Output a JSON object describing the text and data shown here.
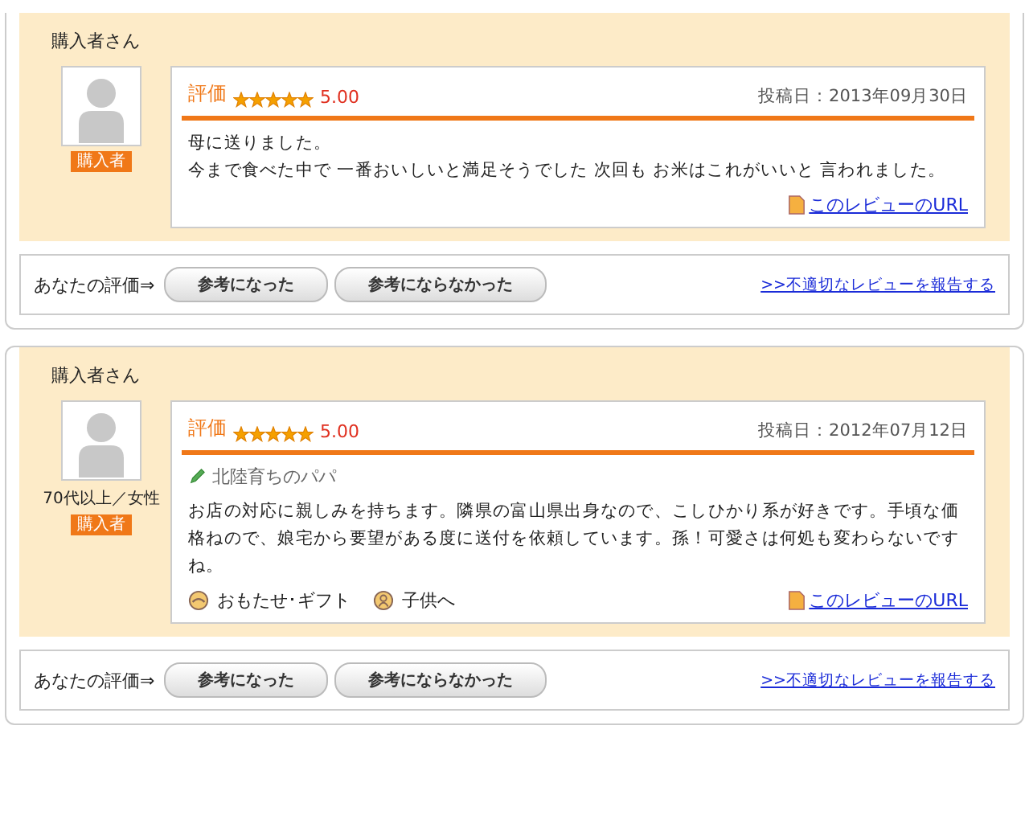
{
  "reviews": [
    {
      "reviewer": "購入者さん",
      "badge": "購入者",
      "rating_label": "評価",
      "stars": 5,
      "score": "5.00",
      "date": "投稿日：2013年09月30日",
      "body": [
        "母に送りました。",
        "今まで食べた中で 一番おいしいと満足そうでした 次回も お米はこれがいいと 言われました。"
      ],
      "url_link": "このレビューのURL",
      "feedback_label": "あなたの評価⇒",
      "buttons": [
        "参考になった",
        "参考にならなかった"
      ],
      "report_link": ">>不適切なレビューを報告する"
    },
    {
      "reviewer": "購入者さん",
      "profile": "70代以上／女性",
      "badge": "購入者",
      "rating_label": "評価",
      "stars": 5,
      "score": "5.00",
      "date": "投稿日：2012年07月12日",
      "nickname": "北陸育ちのパパ",
      "body": [
        "お店の対応に親しみを持ちます。隣県の富山県出身なので、こしひかり系が好きです。手頃な価格ねので、娘宅から要望がある度に送付を依頼しています。孫！可愛さは何処も変わらないですね。"
      ],
      "tags": [
        {
          "kind": "gift",
          "label": "おもたせ･ギフト"
        },
        {
          "kind": "person",
          "label": "子供へ"
        }
      ],
      "url_link": "このレビューのURL",
      "feedback_label": "あなたの評価⇒",
      "buttons": [
        "参考になった",
        "参考にならなかった"
      ],
      "report_link": ">>不適切なレビューを報告する"
    }
  ]
}
